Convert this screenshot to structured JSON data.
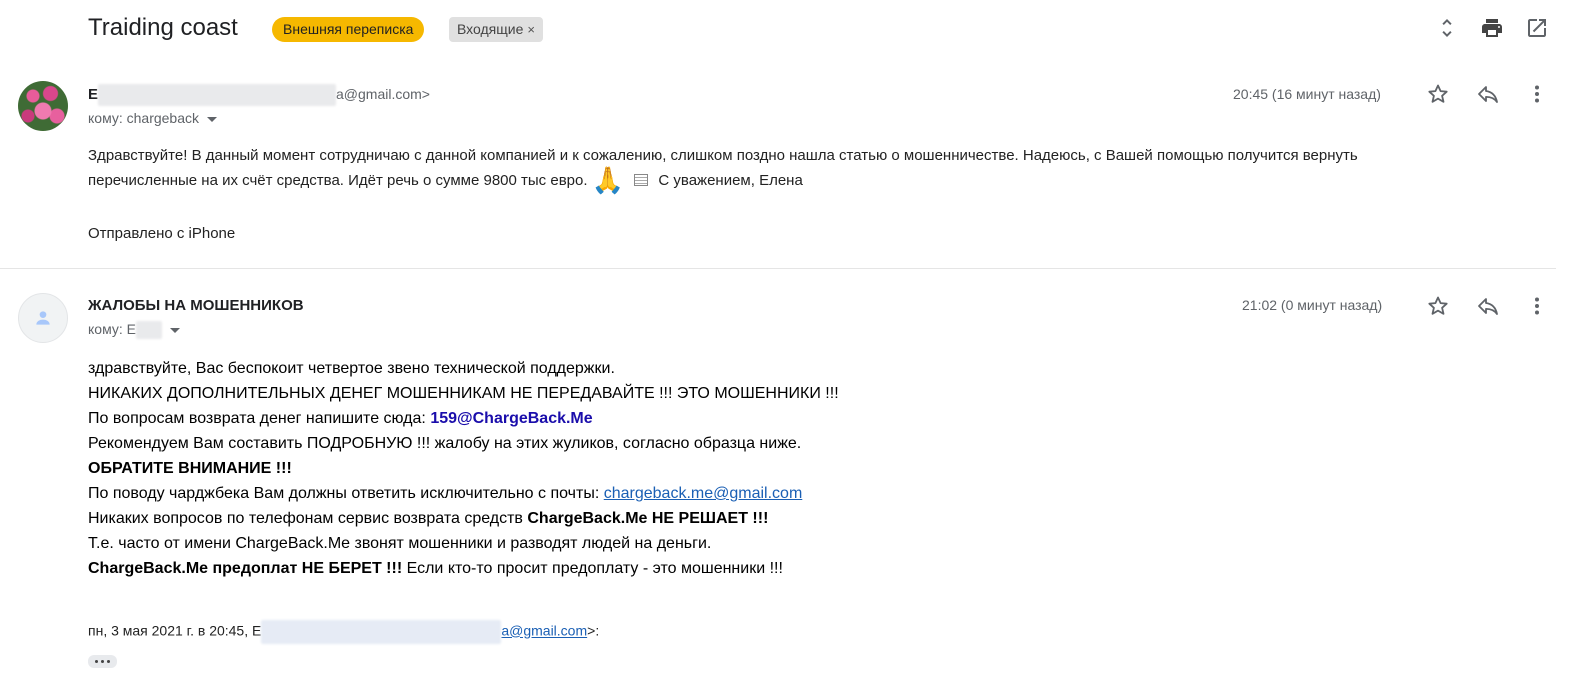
{
  "thread": {
    "subject": "Traiding coast",
    "labels": [
      {
        "text": "Внешняя переписка",
        "color": "#f6b800"
      },
      {
        "text": "Входящие",
        "removable": true,
        "close_glyph": "×"
      }
    ],
    "header_actions": [
      "expand-collapse-icon",
      "print-icon",
      "open-new-window-icon"
    ]
  },
  "message1": {
    "sender_initial": "E",
    "sender_email_tail": "a@gmail.com>",
    "to_label": "кому: chargeback",
    "time": "20:45 (16 минут назад)",
    "body_line1": "Здравствуйте! В данный момент сотрудничаю с данной компанией и к сожалению, слишком поздно нашла статью о мошенничестве. Надеюсь, с Вашей помощью получится вернуть",
    "body_line2": "перечисленные на их счёт средства. Идёт речь о сумме 9800 тыс евро.",
    "emoji": "🙏",
    "signature": "С уважением, Елена",
    "sent_from": "Отправлено с iPhone"
  },
  "message2": {
    "sender": "ЖАЛОБЫ НА МОШЕННИКОВ",
    "to_label": "кому: E",
    "time": "21:02 (0 минут назад)",
    "lines": {
      "l1": "здравствуйте, Вас беспокоит четвертое звено технической поддержки.",
      "l2": "НИКАКИХ ДОПОЛНИТЕЛЬНЫХ ДЕНЕГ МОШЕННИКАМ НЕ ПЕРЕДАВАЙТЕ !!! ЭТО МОШЕННИКИ !!!",
      "l3_prefix": "По вопросам возврата денег напишите сюда: ",
      "l3_link": "159@ChargeBack.Me",
      "l4": "Рекомендуем Вам составить ПОДРОБНУЮ !!! жалобу на этих жуликов, согласно образца ниже.",
      "l5": "ОБРАТИТЕ ВНИМАНИЕ !!!",
      "l6_prefix": "По поводу чарджбека Вам должны ответить исключительно с почты: ",
      "l6_link": "chargeback.me@gmail.com",
      "l7_prefix": "Никаких вопросов по телефонам сервис возврата средств ",
      "l7_bold": "ChargeBack.Me НЕ РЕШАЕТ !!!",
      "l8": "Т.е. часто от имени ChargeBack.Me звонят мошенники и разводят людей на деньги.",
      "l9_bold": "ChargeBack.Me предоплат НЕ БЕРЕТ !!!",
      "l9_rest": " Если кто-то просит предоплату - это мошенники !!!"
    },
    "quote_header_prefix": "пн, 3 мая 2021 г. в 20:45, E",
    "quote_header_email": "a@gmail.com",
    "quote_header_suffix": ">:"
  }
}
